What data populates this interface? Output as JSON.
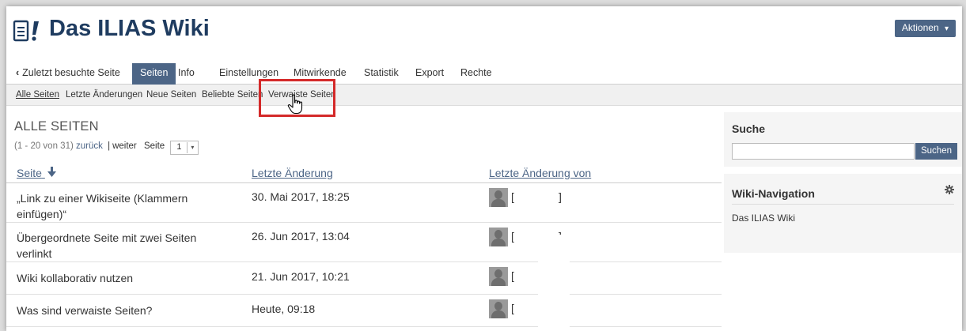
{
  "header": {
    "title": "Das ILIAS Wiki",
    "actions_label": "Aktionen",
    "actions_caret": "▾"
  },
  "tabs": {
    "back_label": "Zuletzt besuchte Seite",
    "back_icon": "‹",
    "items": [
      {
        "label": "Seiten",
        "active": true
      },
      {
        "label": "Info"
      },
      {
        "label": "Einstellungen"
      },
      {
        "label": "Mitwirkende"
      },
      {
        "label": "Statistik"
      },
      {
        "label": "Export"
      },
      {
        "label": "Rechte"
      }
    ]
  },
  "subtabs": [
    {
      "label": "Alle Seiten",
      "active": true
    },
    {
      "label": "Letzte Änderungen"
    },
    {
      "label": "Neue Seiten"
    },
    {
      "label": "Beliebte Seiten"
    },
    {
      "label": "Verwaiste Seiten"
    }
  ],
  "main": {
    "section_title": "ALLE SEITEN",
    "pager": {
      "range": "(1 - 20 von 31)",
      "back": "zurück",
      "separator": "|",
      "next": "weiter",
      "page_label": "Seite",
      "page_value": "1"
    },
    "columns": {
      "page": "Seite",
      "last_change": "Letzte Änderung",
      "last_change_by": "Letzte Änderung von"
    },
    "rows": [
      {
        "page": "„Link zu einer Wikiseite (Klammern einfügen)“",
        "date": "30. Mai 2017, 18:25",
        "bracket_open": "[",
        "bracket_close": "]"
      },
      {
        "page": "Übergeordnete Seite mit zwei Seiten verlinkt",
        "date": "26. Jun 2017, 13:04",
        "bracket_open": "[",
        "bracket_close": "]"
      },
      {
        "page": "Wiki kollaborativ nutzen",
        "date": "21. Jun 2017, 10:21",
        "bracket_open": "[",
        "bracket_close": "]"
      },
      {
        "page": "Was sind verwaiste Seiten?",
        "date": "Heute, 09:18",
        "bracket_open": "[",
        "bracket_close": "]"
      }
    ]
  },
  "sidebar": {
    "search_title": "Suche",
    "search_value": "",
    "search_button": "Suchen",
    "nav_title": "Wiki-Navigation",
    "nav_link": "Das ILIAS Wiki"
  },
  "colors": {
    "accent": "#4c6586",
    "title": "#1f3c60",
    "highlight": "#d42929"
  },
  "icons": {
    "title_icon": "wiki-document-icon",
    "sort_icon": "arrow-down-icon",
    "settings_icon": "gear-icon",
    "cursor_icon": "hand-pointer-icon"
  }
}
